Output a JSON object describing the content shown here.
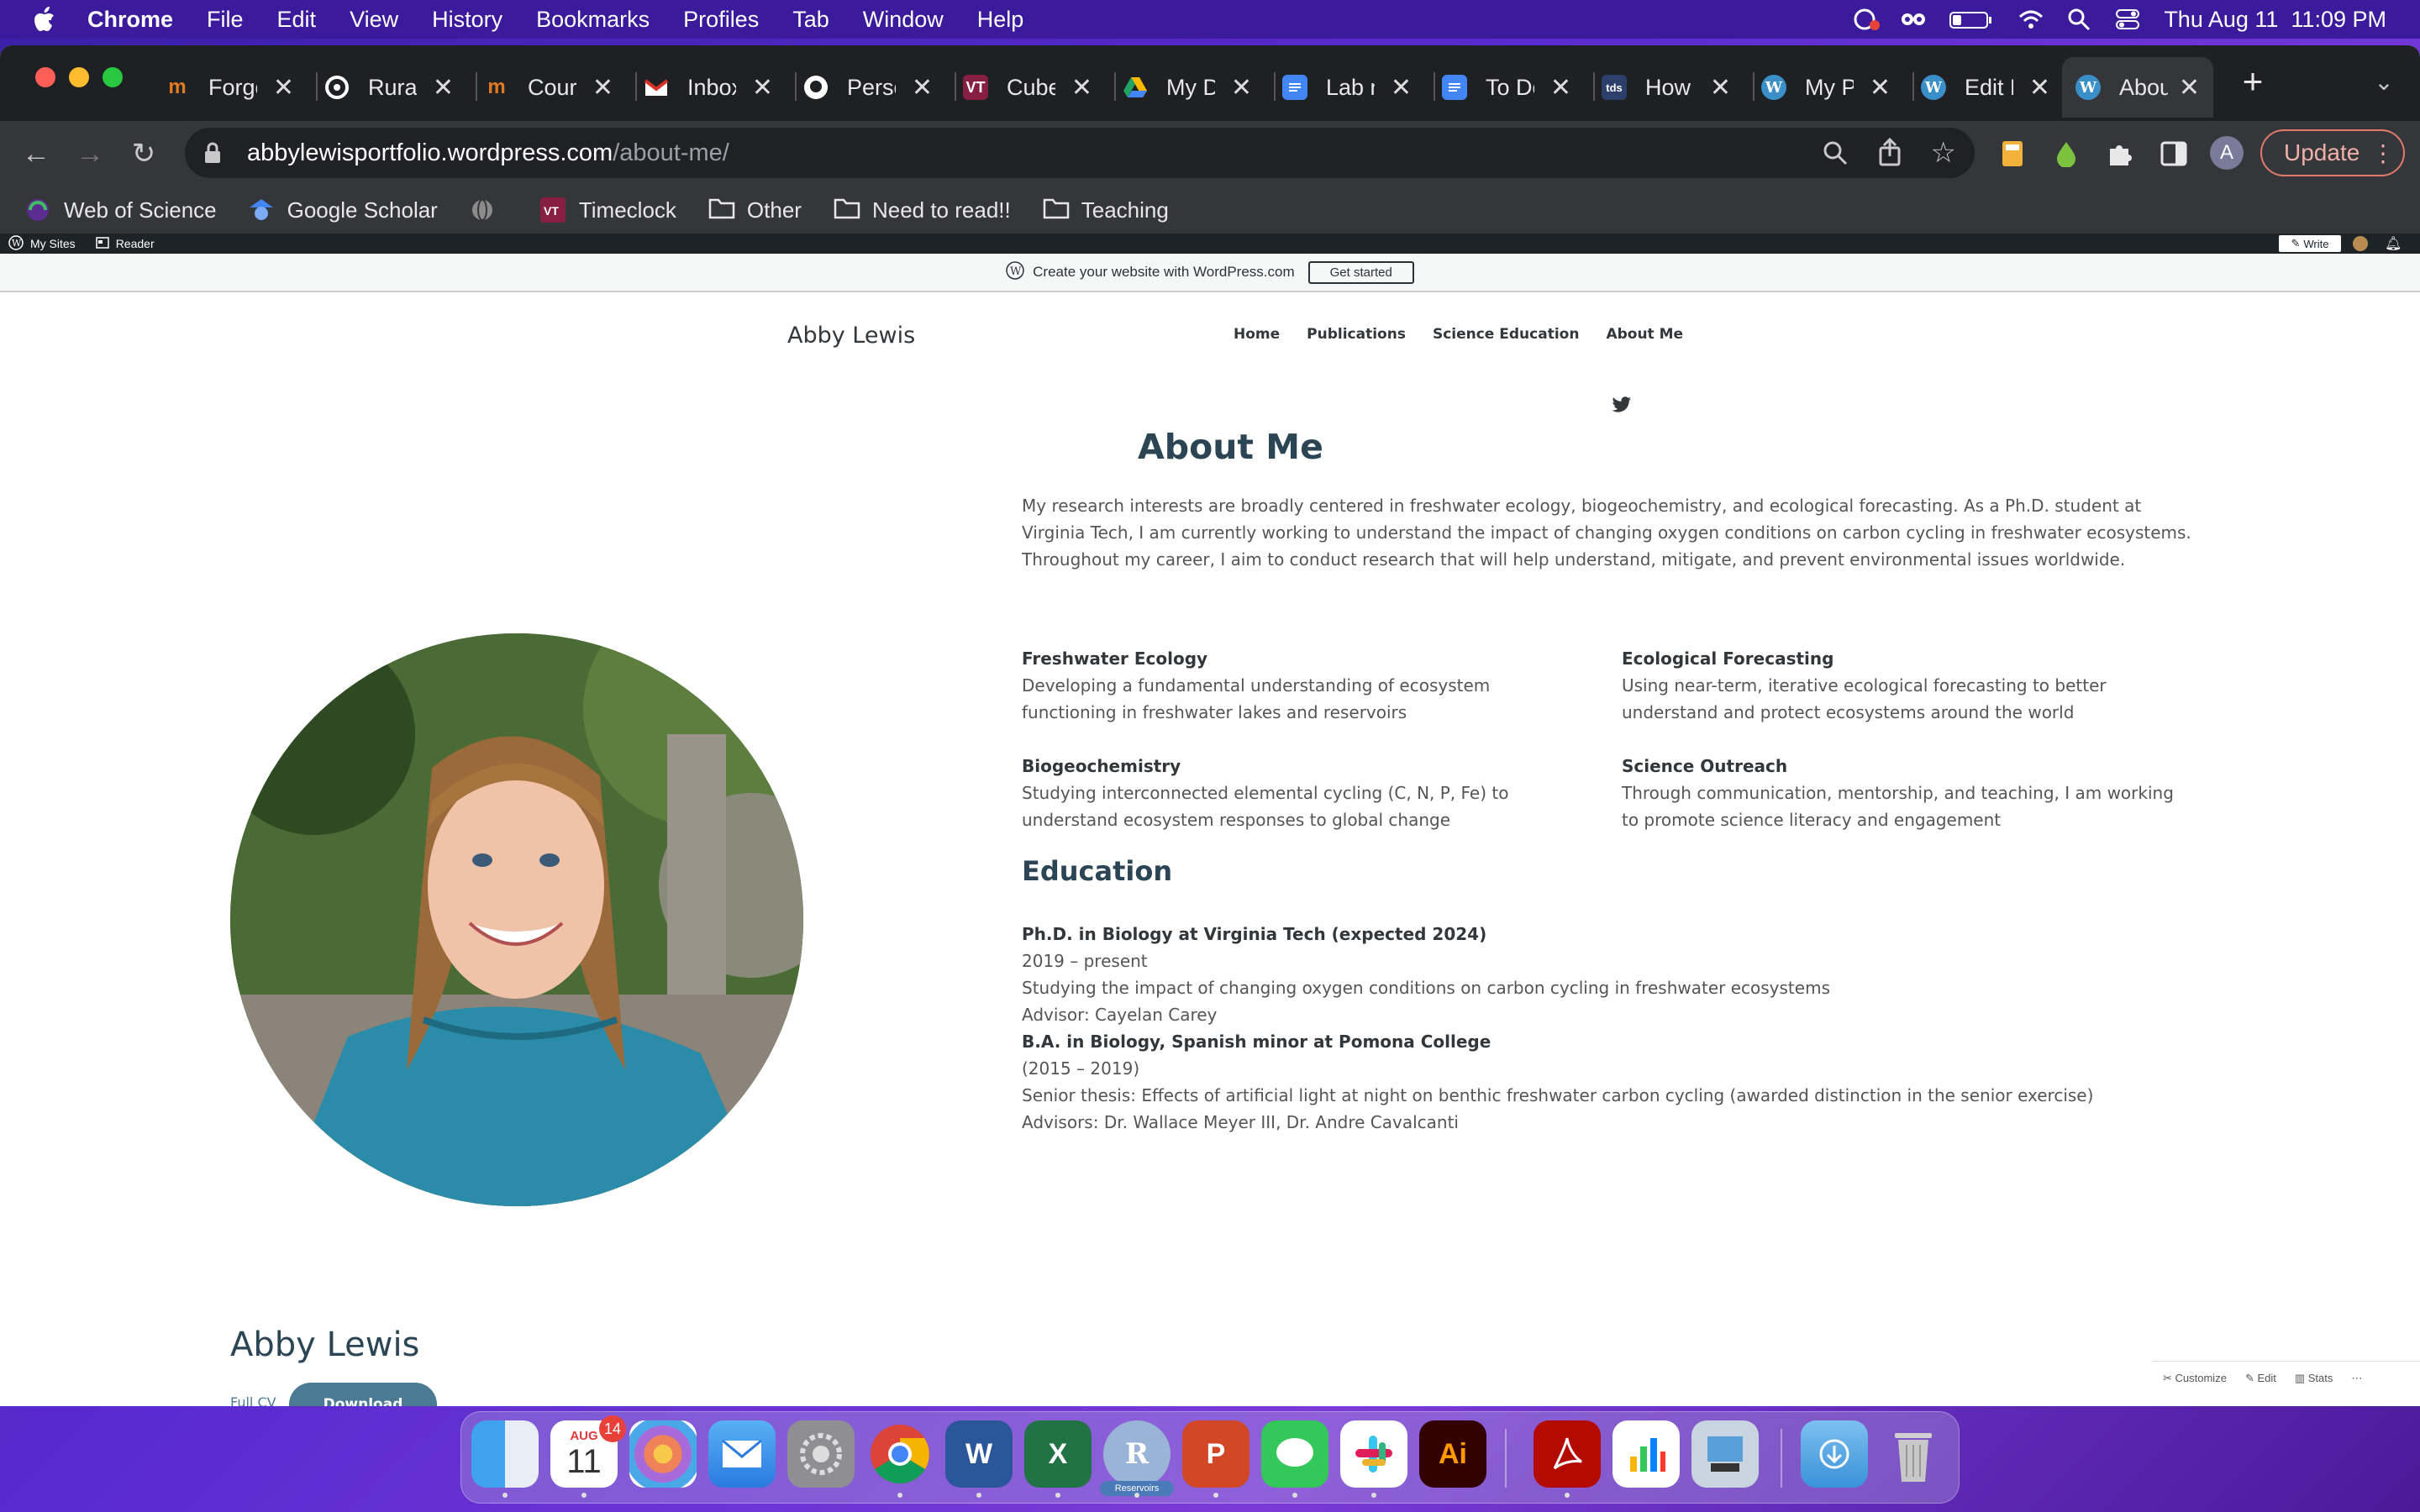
{
  "menubar": {
    "app": "Chrome",
    "items": [
      "File",
      "Edit",
      "View",
      "History",
      "Bookmarks",
      "Profiles",
      "Tab",
      "Window",
      "Help"
    ],
    "datetime": "Thu Aug 11  11:09 PM"
  },
  "tabs": [
    {
      "label": "Forgo",
      "favicon": "researchgate-icon",
      "color": "#c87a1a"
    },
    {
      "label": "Rural",
      "favicon": "circle-logo-icon",
      "color": "#111111"
    },
    {
      "label": "Cour:",
      "favicon": "researchgate-icon",
      "color": "#c87a1a"
    },
    {
      "label": "Inbox",
      "favicon": "gmail-icon",
      "color": "#d93025"
    },
    {
      "label": "Perso",
      "favicon": "github-icon",
      "color": "#ffffff"
    },
    {
      "label": "Cube",
      "favicon": "vt-icon",
      "color": "#861f41"
    },
    {
      "label": "My D",
      "favicon": "google-drive-icon",
      "color": "#1fa463"
    },
    {
      "label": "Lab n",
      "favicon": "google-docs-icon",
      "color": "#4285f4"
    },
    {
      "label": "To Do",
      "favicon": "google-docs-icon",
      "color": "#4285f4"
    },
    {
      "label": "How t",
      "favicon": "tds-icon",
      "color": "#2c3e6b"
    },
    {
      "label": "My P",
      "favicon": "wordpress-icon",
      "color": "#3a8fc9"
    },
    {
      "label": "Edit P",
      "favicon": "wordpress-icon",
      "color": "#3a8fc9"
    },
    {
      "label": "Abou",
      "favicon": "wordpress-icon",
      "color": "#3a8fc9",
      "active": true
    }
  ],
  "address": {
    "domain": "abbylewisportfolio.wordpress.com",
    "path": "/about-me/"
  },
  "toolbar": {
    "update_label": "Update",
    "profile_initial": "A"
  },
  "bookmarks": [
    {
      "label": "Web of Science",
      "icon": "web-of-science-icon"
    },
    {
      "label": "Google Scholar",
      "icon": "google-scholar-icon"
    },
    {
      "label": "",
      "icon": "globe-icon"
    },
    {
      "label": "Timeclock",
      "icon": "vt-icon"
    },
    {
      "label": "Other",
      "icon": "folder-icon"
    },
    {
      "label": "Need to read!!",
      "icon": "folder-icon"
    },
    {
      "label": "Teaching",
      "icon": "folder-icon"
    }
  ],
  "wp_admin": {
    "my_sites": "My Sites",
    "reader": "Reader",
    "write": "Write"
  },
  "banner": {
    "text": "Create your website with WordPress.com",
    "button": "Get started"
  },
  "site": {
    "title": "Abby Lewis",
    "nav": [
      "Home",
      "Publications",
      "Science Education",
      "About Me"
    ],
    "page_title": "About Me",
    "intro": "My research interests are broadly centered in freshwater ecology, biogeochemistry, and ecological forecasting. As a Ph.D. student at Virginia Tech, I am currently working to understand the impact of changing oxygen conditions on carbon cycling in freshwater ecosystems. Throughout my career, I aim to conduct research that will help understand, mitigate, and prevent environmental issues worldwide.",
    "features": [
      {
        "title": "Freshwater Ecology",
        "text": "Developing a fundamental understanding of ecosystem functioning in freshwater lakes and reservoirs"
      },
      {
        "title": "Ecological Forecasting",
        "text": "Using near-term, iterative ecological forecasting to better understand and protect ecosystems around the world"
      },
      {
        "title": "Biogeochemistry",
        "text": "Studying interconnected elemental cycling (C, N, P, Fe) to understand ecosystem responses to global change"
      },
      {
        "title": "Science Outreach",
        "text": "Through communication, mentorship, and teaching, I am working to promote science literacy and engagement"
      }
    ],
    "education_heading": "Education",
    "education": [
      {
        "title": "Ph.D. in Biology at Virginia Tech (expected 2024)",
        "lines": [
          "2019 – present",
          "Studying the impact of changing oxygen conditions on carbon cycling in freshwater ecosystems",
          "Advisor: Cayelan Carey"
        ]
      },
      {
        "title": "B.A. in Biology, Spanish minor at Pomona College",
        "lines": [
          "(2015 – 2019)",
          "Senior thesis: Effects of artificial light at night on benthic freshwater carbon cycling (awarded distinction in the senior exercise)",
          "Advisors: Dr. Wallace Meyer III, Dr. Andre Cavalcanti"
        ]
      }
    ],
    "footer_name": "Abby Lewis",
    "full_cv": "Full CV",
    "download": "Download"
  },
  "wp_footer": [
    "Customize",
    "Edit",
    "Stats"
  ],
  "dock": {
    "calendar_month": "AUG",
    "calendar_day": "11",
    "calendar_badge": "14",
    "r_label": "Reservoirs"
  }
}
